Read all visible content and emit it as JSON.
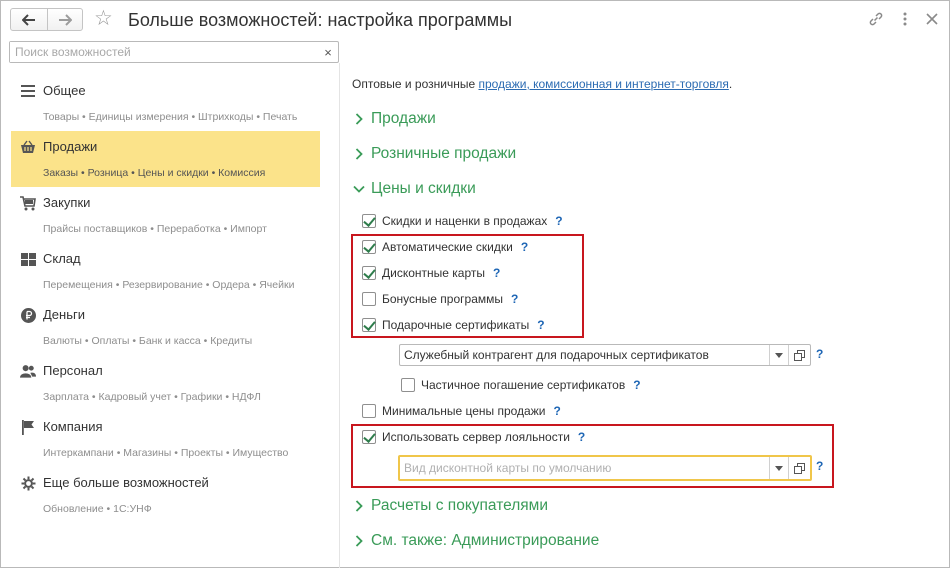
{
  "window": {
    "title": "Больше возможностей: настройка программы"
  },
  "search": {
    "placeholder": "Поиск возможностей",
    "clear_label": "×"
  },
  "sidebar": {
    "sections": [
      {
        "label": "Общее",
        "sub": "Товары • Единицы измерения • Штрихкоды • Печать",
        "icon": "list-icon"
      },
      {
        "label": "Продажи",
        "sub": "Заказы • Розница • Цены и скидки • Комиссия",
        "icon": "basket-icon",
        "active": true
      },
      {
        "label": "Закупки",
        "sub": "Прайсы поставщиков • Переработка • Импорт",
        "icon": "cart-icon"
      },
      {
        "label": "Склад",
        "sub": "Перемещения • Резервирование • Ордера • Ячейки",
        "icon": "grid-icon"
      },
      {
        "label": "Деньги",
        "sub": "Валюты • Оплаты • Банк и касса • Кредиты",
        "icon": "ruble-icon"
      },
      {
        "label": "Персонал",
        "sub": "Зарплата • Кадровый учет • Графики • НДФЛ",
        "icon": "people-icon"
      },
      {
        "label": "Компания",
        "sub": "Интеркампани • Магазины • Проекты • Имущество",
        "icon": "flag-icon"
      },
      {
        "label": "Еще больше возможностей",
        "sub": "Обновление • 1С:УНФ",
        "icon": "gear-icon"
      }
    ]
  },
  "content": {
    "intro_text": "Оптовые и розничные ",
    "intro_link": "продажи, комиссионная и интернет-торговля",
    "intro_end": ".",
    "groups": {
      "sales": "Продажи",
      "retail": "Розничные продажи",
      "prices": "Цены и скидки",
      "settlements": "Расчеты с покупателями",
      "see_also": "См. также: Администрирование"
    },
    "checkboxes": {
      "discounts_in_sales": {
        "label": "Скидки и наценки в продажах",
        "checked": true
      },
      "auto_discounts": {
        "label": "Автоматические скидки",
        "checked": true
      },
      "discount_cards": {
        "label": "Дисконтные карты",
        "checked": true
      },
      "bonus_programs": {
        "label": "Бонусные программы",
        "checked": false
      },
      "gift_certificates": {
        "label": "Подарочные сертификаты",
        "checked": true
      },
      "partial_redemption": {
        "label": "Частичное погашение сертификатов",
        "checked": false
      },
      "min_prices": {
        "label": "Минимальные цены продажи",
        "checked": false
      },
      "loyalty_server": {
        "label": "Использовать сервер лояльности",
        "checked": true
      }
    },
    "fields": {
      "service_counterparty": {
        "value": "Служебный контрагент для подарочных сертификатов"
      },
      "default_card_kind": {
        "placeholder": "Вид дисконтной карты по умолчанию"
      }
    },
    "help_mark": "?"
  },
  "colors": {
    "accent_green": "#3a9b58",
    "active_section": "#fbe38a",
    "link": "#2b6bb2",
    "highlight_red": "#c8161e",
    "focus_yellow": "#f0c64a"
  }
}
